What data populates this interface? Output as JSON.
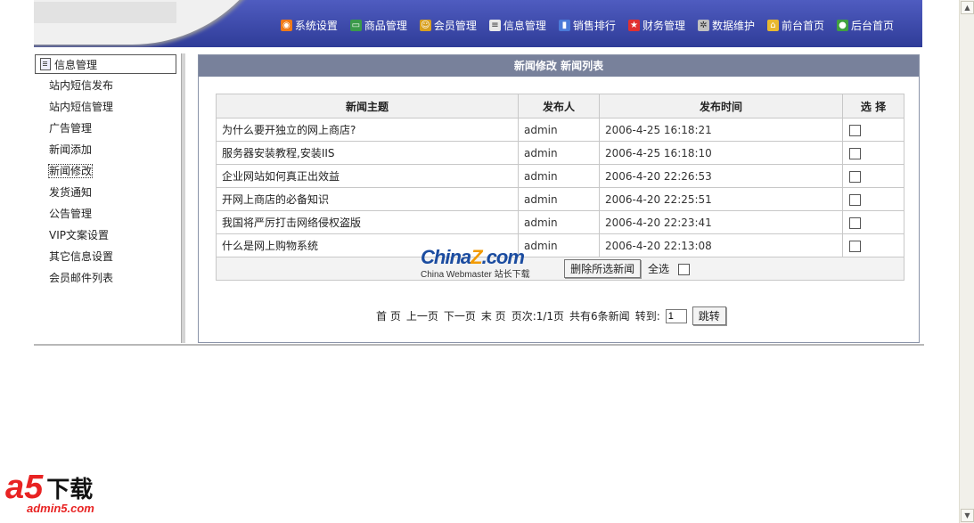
{
  "nav": [
    {
      "label": "系统设置",
      "icon": "rss-icon",
      "color": "#f07a18"
    },
    {
      "label": "商品管理",
      "icon": "monitor-icon",
      "color": "#3a9a4a"
    },
    {
      "label": "会员管理",
      "icon": "users-icon",
      "color": "#d8a020"
    },
    {
      "label": "信息管理",
      "icon": "document-icon",
      "color": "#e8e8e8"
    },
    {
      "label": "销售排行",
      "icon": "bar-chart-icon",
      "color": "#4a7ad8"
    },
    {
      "label": "财务管理",
      "icon": "star-icon",
      "color": "#e03030"
    },
    {
      "label": "数据维护",
      "icon": "gear-icon",
      "color": "#c0c0c0"
    },
    {
      "label": "前台首页",
      "icon": "home-icon",
      "color": "#e8b830"
    },
    {
      "label": "后台首页",
      "icon": "globe-icon",
      "color": "#40a040"
    }
  ],
  "sidebar": {
    "header": "信息管理",
    "items": [
      "站内短信发布",
      "站内短信管理",
      "广告管理",
      "新闻添加",
      "新闻修改",
      "发货通知",
      "公告管理",
      "VIP文案设置",
      "其它信息设置",
      "会员邮件列表"
    ],
    "active_index": 4
  },
  "main": {
    "title": "新闻修改  新闻列表",
    "columns": [
      "新闻主题",
      "发布人",
      "发布时间",
      "选  择"
    ],
    "rows": [
      {
        "subject": "为什么要开独立的网上商店?",
        "publisher": "admin",
        "time": "2006-4-25 16:18:21"
      },
      {
        "subject": "服务器安装教程,安装IIS",
        "publisher": "admin",
        "time": "2006-4-25 16:18:10"
      },
      {
        "subject": "企业网站如何真正出效益",
        "publisher": "admin",
        "time": "2006-4-20 22:26:53"
      },
      {
        "subject": "开网上商店的必备知识",
        "publisher": "admin",
        "time": "2006-4-20 22:25:51"
      },
      {
        "subject": "我国将严厉打击网络侵权盗版",
        "publisher": "admin",
        "time": "2006-4-20 22:23:41"
      },
      {
        "subject": "什么是网上购物系统",
        "publisher": "admin",
        "time": "2006-4-20 22:13:08"
      }
    ],
    "delete_button": "删除所选新闻",
    "select_all": "全选"
  },
  "pager": {
    "first": "首 页",
    "prev": "上一页",
    "next": "下一页",
    "last": "末 页",
    "page_info": "页次:1/1页",
    "total": "共有6条新闻",
    "goto_label": "转到:",
    "goto_value": "1",
    "jump_button": "跳转"
  },
  "watermarks": {
    "china_big_a": "China",
    "china_big_z": "Z",
    "china_big_b": ".com",
    "china_small": "China Webmaster 站长下载",
    "a5_mark": "a5",
    "a5_text": "下载",
    "a5_url": "admin5.com"
  }
}
